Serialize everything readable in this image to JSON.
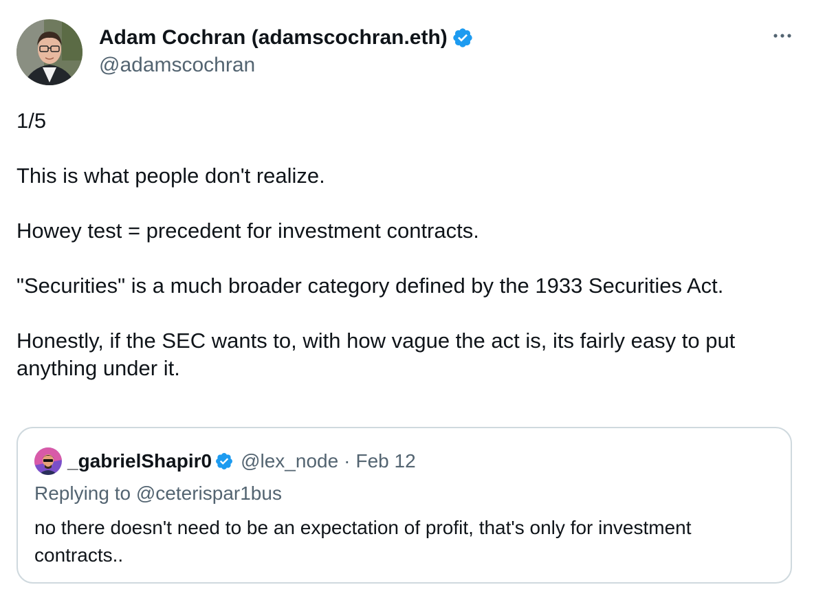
{
  "author": {
    "name": "Adam Cochran (adamscochran.eth)",
    "handle": "@adamscochran",
    "verified_color": "#1d9bf0"
  },
  "tweet": {
    "paragraphs": [
      "1/5",
      "This is what people don't realize.",
      "Howey test = precedent for investment contracts.",
      "\"Securities\" is a much broader category defined by the 1933 Securities Act.",
      "Honestly, if the SEC wants to, with how vague the act is, its fairly easy to put anything under it."
    ]
  },
  "quoted": {
    "name": "_gabrielShapir0",
    "handle": "@lex_node",
    "separator": "·",
    "date": "Feb 12",
    "replying_to": "Replying to @ceterispar1bus",
    "text": "no there doesn't need to be an expectation of profit, that's only for investment contracts.."
  },
  "icons": {
    "more": "more-horizontal-icon",
    "verified": "verified-badge-icon"
  }
}
